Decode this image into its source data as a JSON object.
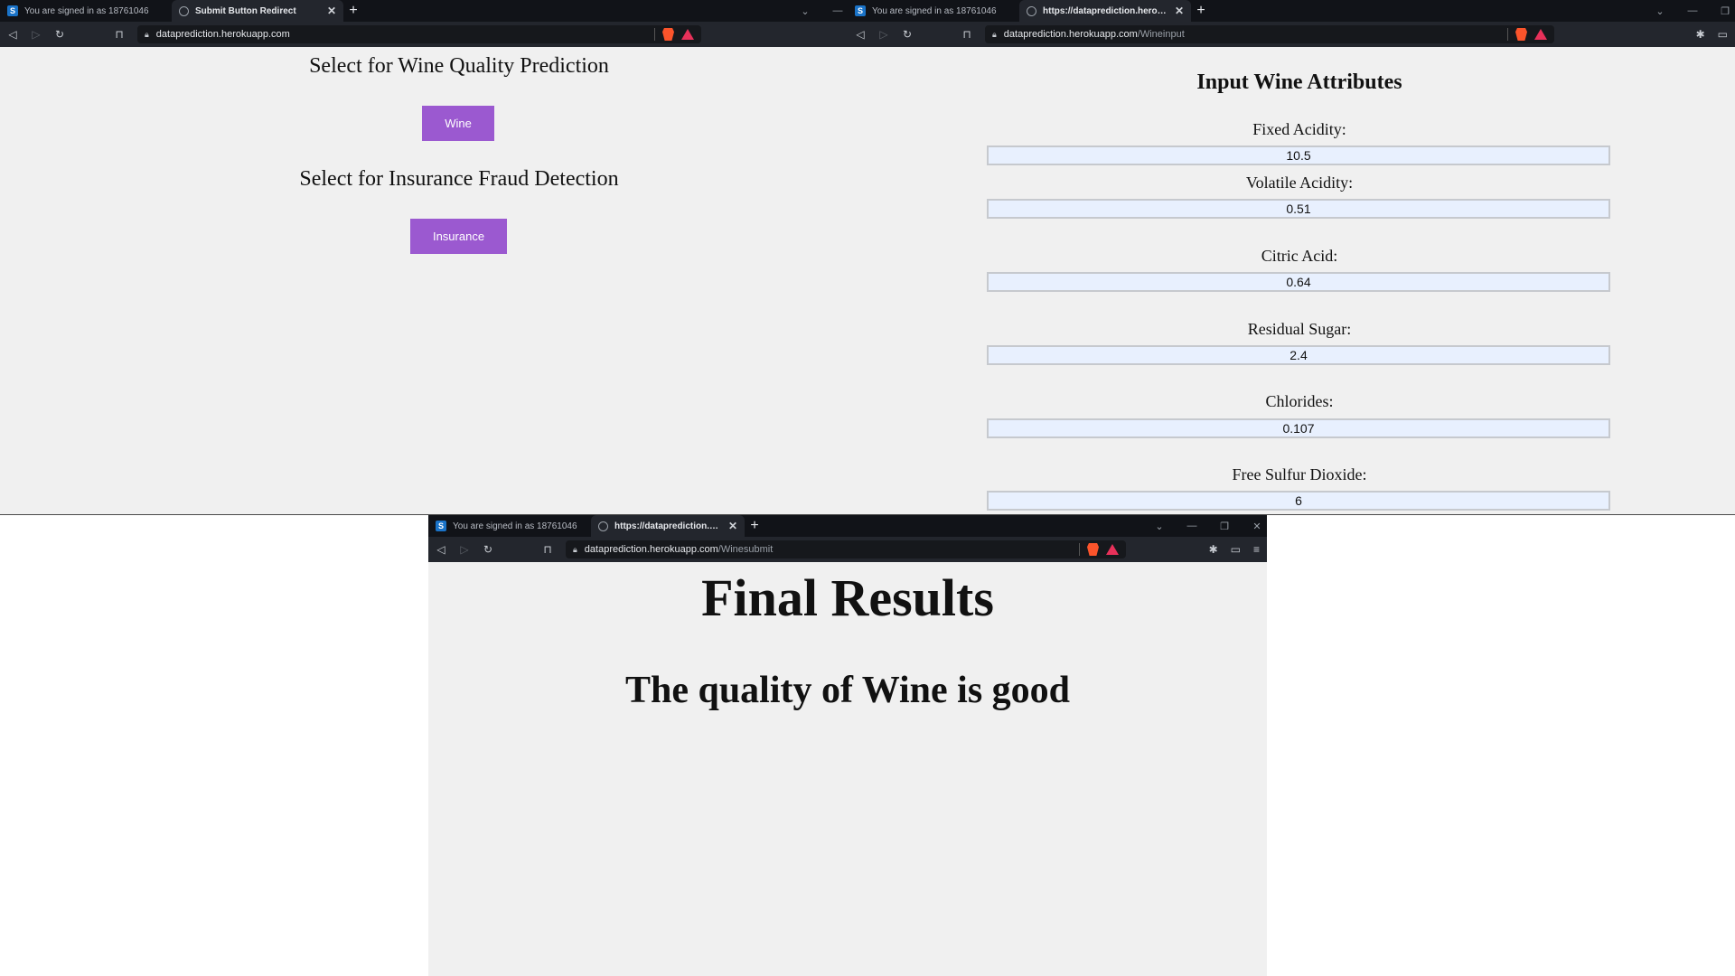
{
  "window_a": {
    "tabs": [
      {
        "title": "You are signed in as 18761046",
        "favicon": "s-logo-icon"
      },
      {
        "title": "Submit Button Redirect",
        "favicon": "globe-icon",
        "active": true
      }
    ],
    "url_host": "dataprediction.herokuapp.com",
    "url_path": "",
    "page": {
      "wine_heading": "Select for Wine Quality Prediction",
      "wine_button": "Wine",
      "insurance_heading": "Select for Insurance Fraud Detection",
      "insurance_button": "Insurance"
    }
  },
  "window_b": {
    "tabs": [
      {
        "title": "You are signed in as 18761046",
        "favicon": "s-logo-icon"
      },
      {
        "title": "https://dataprediction.herokuapp",
        "favicon": "globe-icon",
        "active": true
      }
    ],
    "url_host": "dataprediction.herokuapp.com",
    "url_path": "/Wineinput",
    "page": {
      "title": "Input Wine Attributes",
      "fields": [
        {
          "label": "Fixed Acidity:",
          "value": "10.5"
        },
        {
          "label": "Volatile Acidity:",
          "value": "0.51"
        },
        {
          "label": "Citric Acid:",
          "value": "0.64"
        },
        {
          "label": "Residual Sugar:",
          "value": "2.4"
        },
        {
          "label": "Chlorides:",
          "value": "0.107"
        },
        {
          "label": "Free Sulfur Dioxide:",
          "value": "6"
        }
      ]
    }
  },
  "window_c": {
    "tabs": [
      {
        "title": "You are signed in as 18761046",
        "favicon": "s-logo-icon"
      },
      {
        "title": "https://dataprediction.herokuapp",
        "favicon": "globe-icon",
        "active": true
      }
    ],
    "url_host": "dataprediction.herokuapp.com",
    "url_path": "/Winesubmit",
    "page": {
      "title": "Final Results",
      "result": "The quality of Wine is good"
    }
  },
  "colors": {
    "button": "#9b59d0",
    "page_bg": "#f0f0f0",
    "input_bg": "#e8f0fe",
    "tabbar_bg": "#111318",
    "toolbar_bg": "#23262d"
  }
}
